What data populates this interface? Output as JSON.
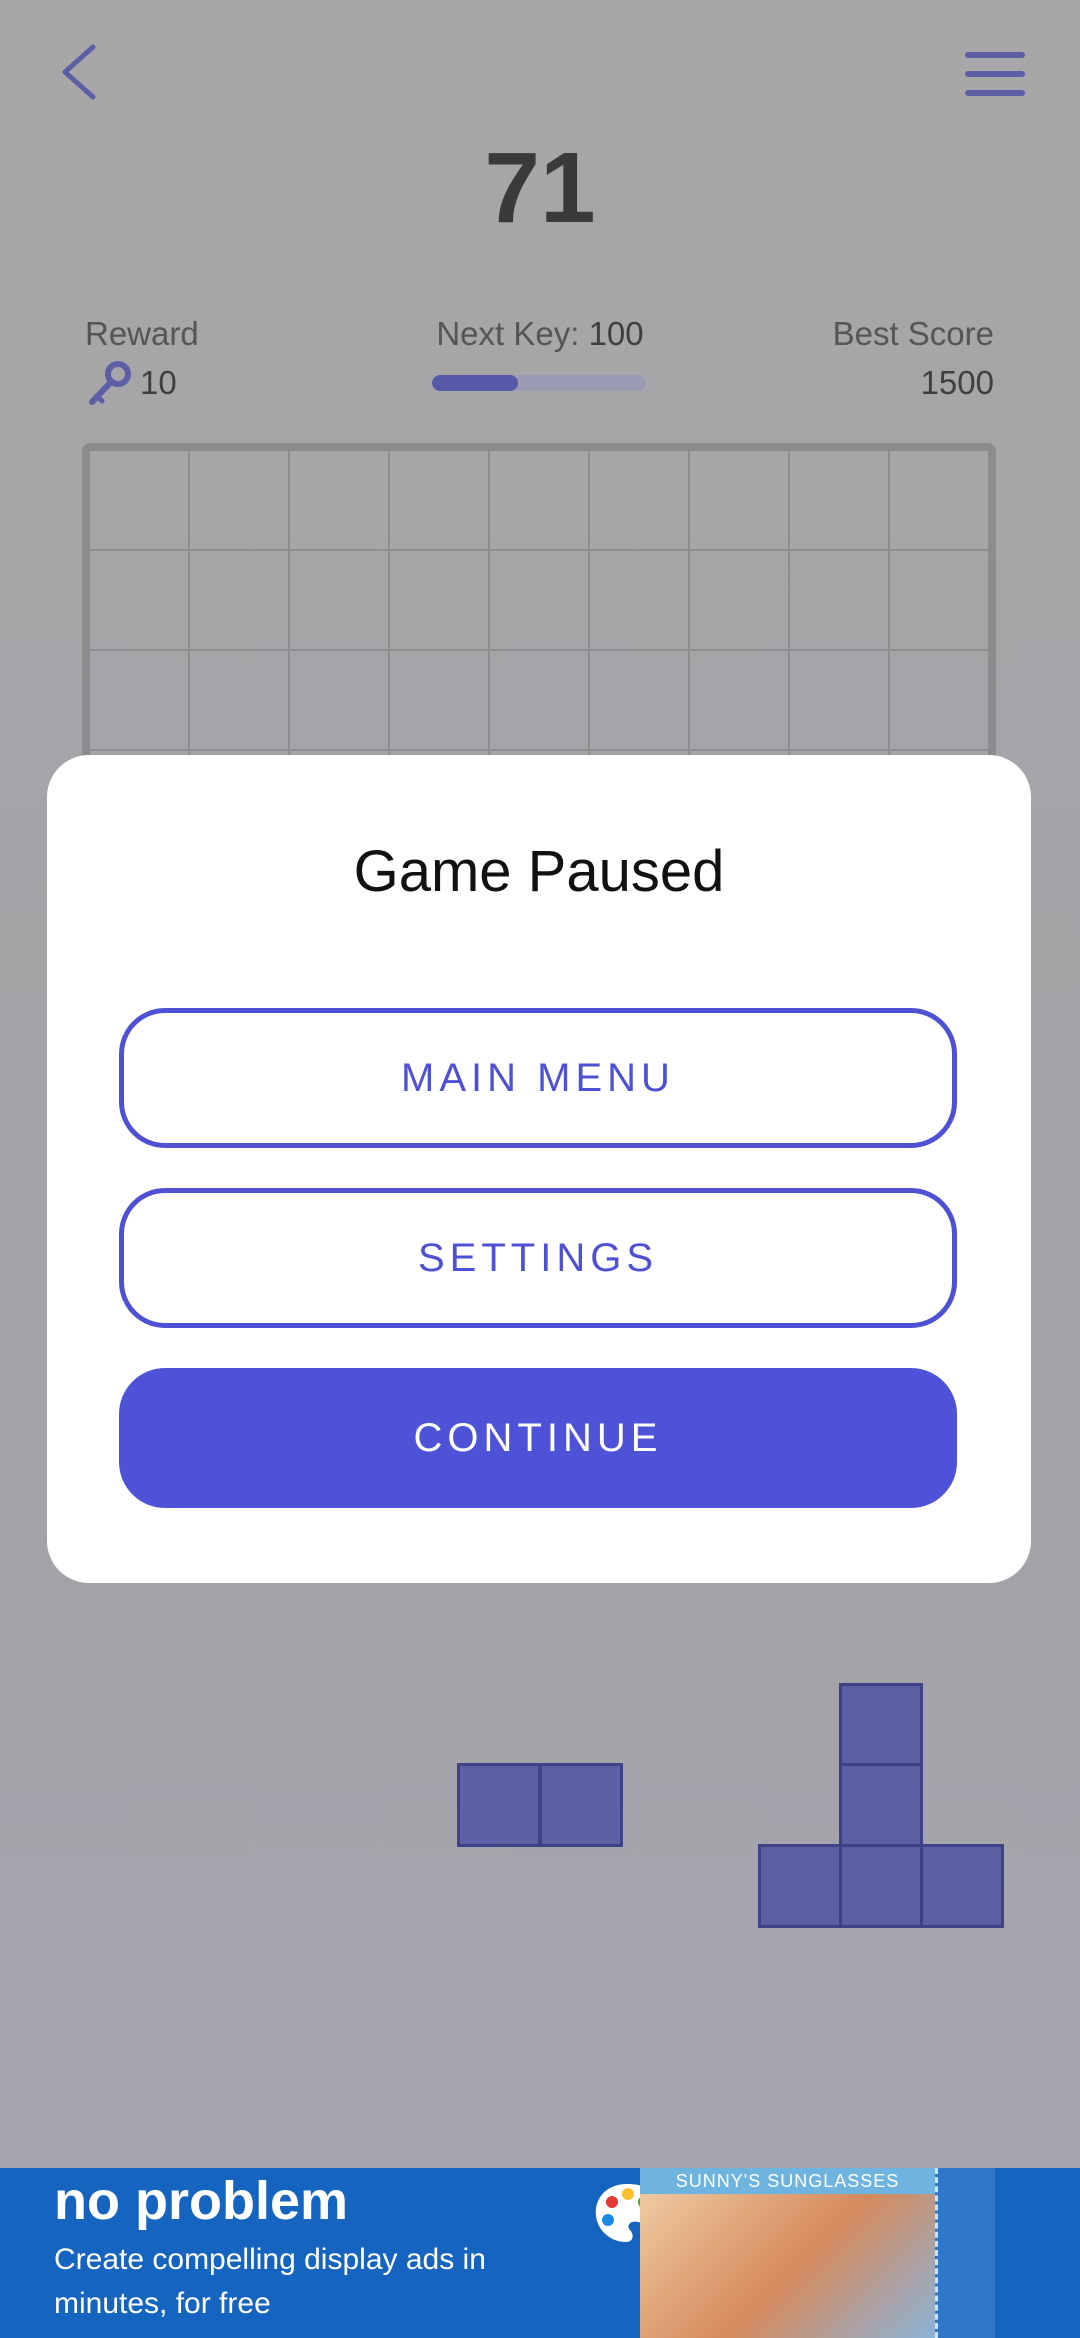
{
  "header": {
    "back_icon": "chevron-left-icon",
    "menu_icon": "hamburger-menu-icon",
    "score": "71"
  },
  "stats": {
    "reward_label": "Reward",
    "reward_value": "10",
    "reward_icon": "key-icon",
    "next_key_label": "Next Key:",
    "next_key_value": "100",
    "next_key_progress": 0.4,
    "best_label": "Best Score",
    "best_value": "1500"
  },
  "dialog": {
    "title": "Game Paused",
    "main_menu_label": "MAIN MENU",
    "settings_label": "SETTINGS",
    "continue_label": "CONTINUE"
  },
  "ad": {
    "headline": "no problem",
    "body": "Create compelling display ads in minutes, for free",
    "photo_caption": "SUNNY'S SUNGLASSES"
  },
  "colors": {
    "accent": "#4f51d4",
    "piece": "#5d5fa4"
  }
}
